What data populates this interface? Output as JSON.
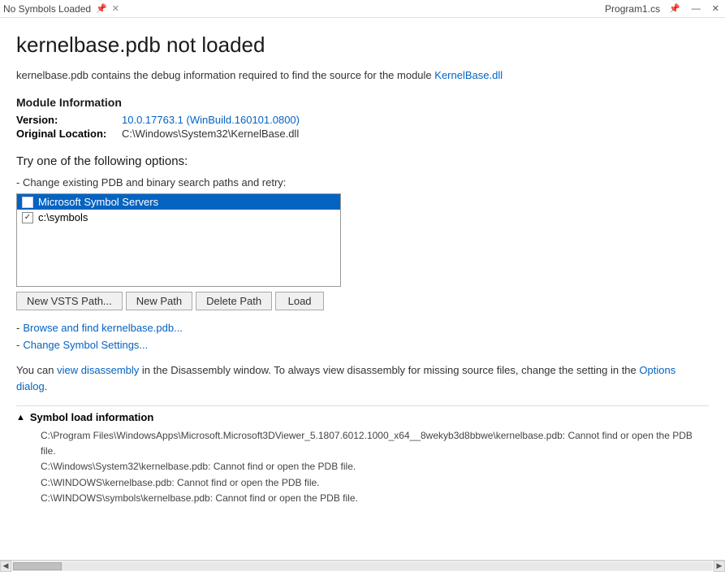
{
  "titleBar": {
    "tabLabel": "No Symbols Loaded",
    "pinIcon": "📌",
    "closeIcon": "✕",
    "filenameRight": "Program1.cs",
    "pinIconRight": "📌",
    "minIcon": "—",
    "closeIconRight": "✕"
  },
  "page": {
    "title": "kernelbase.pdb not loaded",
    "description_prefix": "kernelbase.pdb contains the debug information required to find the source for the module ",
    "description_module": "KernelBase.dll",
    "moduleInfo": {
      "sectionTitle": "Module Information",
      "versionLabel": "Version:",
      "versionValue": "10.0.17763.1 (WinBuild.160101.0800)",
      "locationLabel": "Original Location:",
      "locationValue": "C:\\Windows\\System32\\KernelBase.dll"
    },
    "optionsTitle": "Try one of the following options:",
    "subSectionLabel": "- Change existing PDB and binary search paths and retry:",
    "paths": [
      {
        "label": "Microsoft Symbol Servers",
        "checked": false,
        "selected": true
      },
      {
        "label": "c:\\symbols",
        "checked": true,
        "selected": false
      }
    ],
    "buttons": {
      "newVstsPath": "New VSTS Path...",
      "newPath": "New Path",
      "deletePath": "Delete Path",
      "load": "Load"
    },
    "links": [
      {
        "dash": "-",
        "text": "Browse and find kernelbase.pdb..."
      },
      {
        "dash": "-",
        "text": "Change Symbol Settings..."
      }
    ],
    "infoLine": {
      "prefix": "You can ",
      "linkText": "view disassembly",
      "middle": " in the Disassembly window. To always view disassembly for missing source files, change the setting in the ",
      "linkText2": "Options dialog",
      "suffix": "."
    },
    "symbolSection": {
      "chevron": "▲",
      "title": "Symbol load information",
      "logLines": [
        "C:\\Program Files\\WindowsApps\\Microsoft.Microsoft3DViewer_5.1807.6012.1000_x64__8wekyb3d8bbwe\\kernelbase.pdb: Cannot find or open the PDB file.",
        "C:\\Windows\\System32\\kernelbase.pdb: Cannot find or open the PDB file.",
        "C:\\WINDOWS\\kernelbase.pdb: Cannot find or open the PDB file.",
        "C:\\WINDOWS\\symbols\\kernelbase.pdb: Cannot find or open the PDB file."
      ]
    }
  }
}
